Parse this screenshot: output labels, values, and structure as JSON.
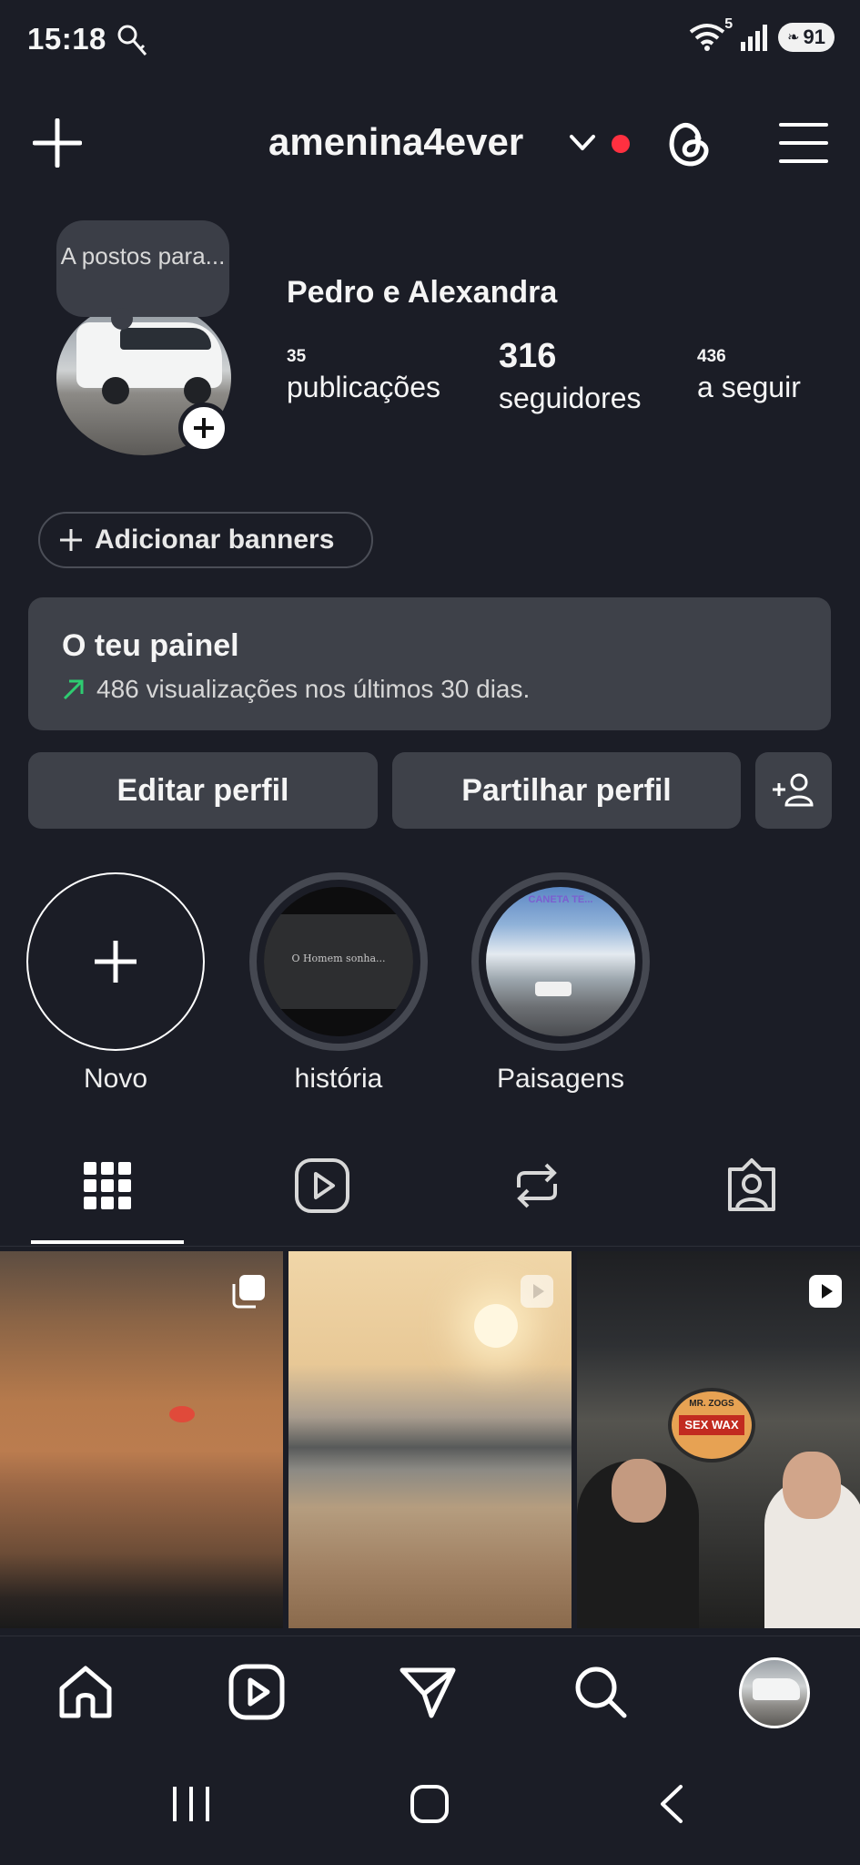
{
  "status_bar": {
    "time": "15:18",
    "wifi_badge": "5",
    "battery": "91"
  },
  "header": {
    "username": "amenina4ever"
  },
  "profile": {
    "note": "A postos para...",
    "display_name": "Pedro e Alexandra",
    "stats": [
      {
        "value": "35",
        "label": "publicações"
      },
      {
        "value": "316",
        "label": "seguidores"
      },
      {
        "value": "436",
        "label": "a seguir"
      }
    ]
  },
  "banners_button": "Adicionar banners",
  "dashboard": {
    "title": "O teu painel",
    "subtitle": "486 visualizações nos últimos 30 dias."
  },
  "actions": {
    "edit": "Editar perfil",
    "share": "Partilhar perfil"
  },
  "highlights": [
    {
      "label": "Novo"
    },
    {
      "label": "história",
      "cover_text": "O Homem sonha..."
    },
    {
      "label": "Paisagens",
      "cover_text": "CANETA TE..."
    }
  ],
  "post3_sign": {
    "line1": "MR. ZOGS",
    "line2": "SEX WAX"
  },
  "colors": {
    "background": "#1b1d26",
    "surface": "#3e4149",
    "notification_dot": "#ff3040",
    "trend_arrow": "#2ecc71"
  }
}
